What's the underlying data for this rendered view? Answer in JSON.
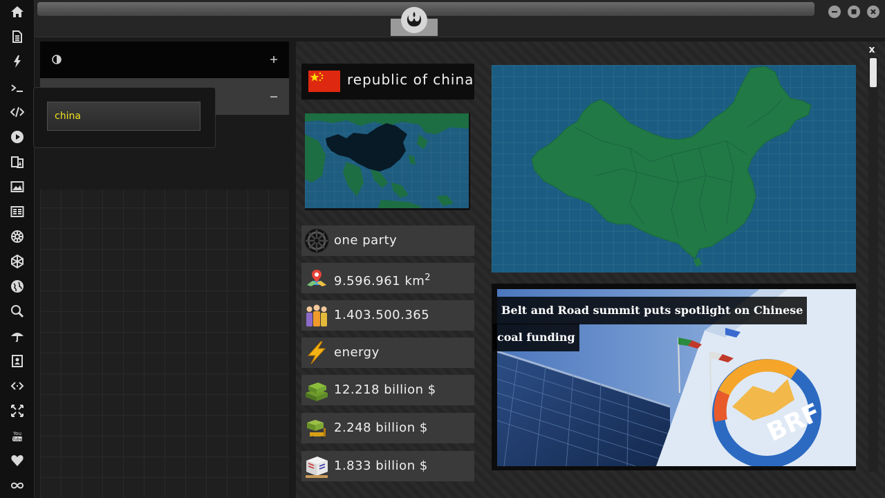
{
  "country": {
    "name": "republic of china",
    "flag_color": "#de2910"
  },
  "search": {
    "query": "china"
  },
  "stats": [
    {
      "icon": "empire-icon",
      "value": "one party",
      "sup": ""
    },
    {
      "icon": "map-pin-icon",
      "value": "9.596.961 km",
      "sup": "2"
    },
    {
      "icon": "people-icon",
      "value": "1.403.500.365",
      "sup": ""
    },
    {
      "icon": "lightning-icon",
      "value": "energy",
      "sup": ""
    },
    {
      "icon": "money-stack-icon",
      "value": "12.218 billion $",
      "sup": ""
    },
    {
      "icon": "export-money-icon",
      "value": "2.248 billion $",
      "sup": ""
    },
    {
      "icon": "import-boxes-icon",
      "value": "1.833 billion $",
      "sup": ""
    }
  ],
  "news": {
    "headline_line1": "Belt and Road summit puts spotlight on Chinese",
    "headline_line2": "coal funding",
    "logo_text": "BRF"
  },
  "window": {
    "close_label": "x"
  },
  "colors": {
    "map_ocean": "#1b5d82",
    "map_land": "#217a45",
    "query_text": "#f0e020"
  }
}
